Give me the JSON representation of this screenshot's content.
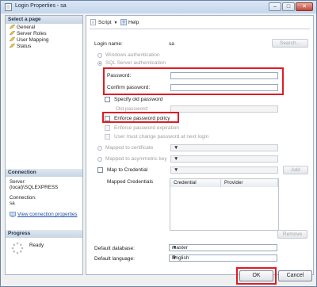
{
  "window": {
    "title": "Login Properties - sa"
  },
  "left": {
    "select_page_header": "Select a page",
    "pages": [
      "General",
      "Server Roles",
      "User Mapping",
      "Status"
    ],
    "connection_header": "Connection",
    "server_label": "Server:",
    "server_value": "(local)\\SQLEXPRESS",
    "connection_label": "Connection:",
    "connection_value": "sa",
    "view_link": "View connection properties",
    "progress_header": "Progress",
    "progress_status": "Ready"
  },
  "toolbar": {
    "script": "Script",
    "help": "Help"
  },
  "form": {
    "login_name_label": "Login name:",
    "login_name_value": "sa",
    "search_button": "Search...",
    "windows_auth": "Windows authentication",
    "sql_auth": "SQL Server authentication",
    "password_label": "Password:",
    "confirm_label": "Confirm password:",
    "specify_old": "Specify old password",
    "old_password": "Old password:",
    "enforce_policy": "Enforce password policy",
    "enforce_expiration": "Enforce password expiration",
    "must_change": "User must change password at next login",
    "mapped_cert": "Mapped to certificate",
    "mapped_asym": "Mapped to asymmetric key",
    "map_credential": "Map to Credential",
    "add_button": "Add",
    "mapped_credentials": "Mapped Credentials",
    "grid_col_credential": "Credential",
    "grid_col_provider": "Provider",
    "remove_button": "Remove",
    "default_db_label": "Default database:",
    "default_db_value": "master",
    "default_lang_label": "Default language:",
    "default_lang_value": "English"
  },
  "buttons": {
    "ok": "OK",
    "cancel": "Cancel"
  },
  "colors": {
    "highlight": "#e01b23",
    "link": "#1a4ea3",
    "title_bar": "#c5d6ec"
  }
}
